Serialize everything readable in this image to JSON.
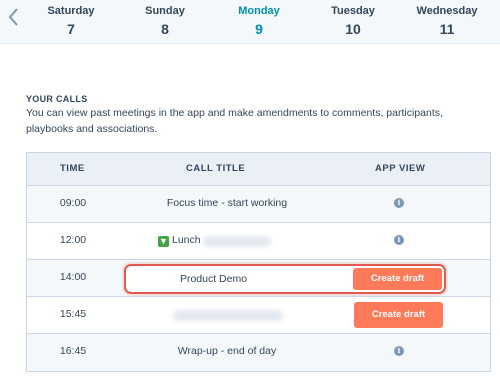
{
  "days": [
    {
      "name": "Saturday",
      "num": "7"
    },
    {
      "name": "Sunday",
      "num": "8"
    },
    {
      "name": "Monday",
      "num": "9"
    },
    {
      "name": "Tuesday",
      "num": "10"
    },
    {
      "name": "Wednesday",
      "num": "11"
    }
  ],
  "active_day": "Monday",
  "section": {
    "title": "YOUR CALLS",
    "description": "You can view past meetings in the app and make amendments to comments, participants, playbooks and associations."
  },
  "table": {
    "headers": {
      "time": "TIME",
      "title": "CALL TITLE",
      "app_view": "APP VIEW"
    },
    "rows": [
      {
        "time": "09:00",
        "title": "Focus time - start working"
      },
      {
        "time": "12:00",
        "title": "Lunch"
      },
      {
        "time": "14:00",
        "title": "Product Demo",
        "action": "Create draft"
      },
      {
        "time": "15:45",
        "title": "",
        "action": "Create draft"
      },
      {
        "time": "16:45",
        "title": "Wrap-up - end of day"
      }
    ]
  },
  "colors": {
    "accent": "#0091ae",
    "button": "#ff7a59",
    "highlight": "#e05a4f"
  },
  "icons": {
    "back": "chevron-left-icon",
    "info": "info-icon",
    "lunch": "green-arrow-icon"
  }
}
